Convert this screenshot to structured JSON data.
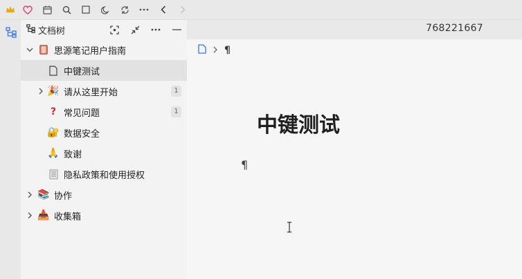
{
  "toolbar": {
    "icons": [
      "crown-icon",
      "heart-icon",
      "calendar-icon",
      "search-icon",
      "square-icon",
      "moon-icon",
      "sync-icon",
      "more-icon",
      "back-icon",
      "forward-icon"
    ]
  },
  "tree": {
    "header_title": "文档树",
    "notebook": "思源笔记用户指南",
    "items": [
      {
        "label": "中键测试",
        "badge": ""
      },
      {
        "label": "请从这里开始",
        "badge": "1"
      },
      {
        "label": "常见问题",
        "badge": "1"
      },
      {
        "label": "数据安全",
        "badge": ""
      },
      {
        "label": "致谢",
        "badge": ""
      },
      {
        "label": "隐私政策和使用授权",
        "badge": ""
      }
    ],
    "notebooks": [
      "协作",
      "收集箱"
    ]
  },
  "editor": {
    "doc_id": "768221667",
    "breadcrumb_pilcrow": "¶",
    "title": "中键测试",
    "paragraph_mark": "¶"
  },
  "colors": {
    "accent": "#3575f0",
    "crown": "#e7a917",
    "heart": "#e0457b"
  }
}
